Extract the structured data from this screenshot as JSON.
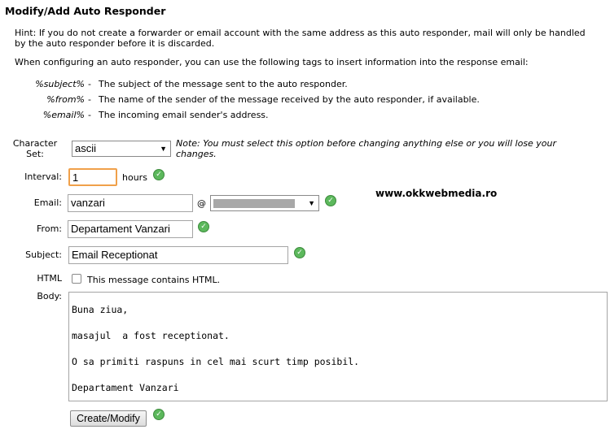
{
  "page": {
    "title": "Modify/Add Auto Responder",
    "hint": "Hint: If you do not create a forwarder or email account with the same address as this auto responder, mail will only be handled by the auto responder before it is discarded.",
    "intro": "When configuring an auto responder, you can use the following tags to insert information into the response email:"
  },
  "tags": [
    {
      "code": "%subject%",
      "dash": "-",
      "desc": "The subject of the message sent to the auto responder."
    },
    {
      "code": "%from%",
      "dash": "-",
      "desc": "The name of the sender of the message received by the auto responder, if available."
    },
    {
      "code": "%email%",
      "dash": "-",
      "desc": "The incoming email sender's address."
    }
  ],
  "form": {
    "charset_label_1": "Character",
    "charset_label_2": "Set:",
    "charset_value": "ascii",
    "charset_note": "Note: You must select this option before changing anything else or you will lose your changes.",
    "interval_label": "Interval:",
    "interval_value": "1",
    "interval_unit": "hours",
    "email_label": "Email:",
    "email_value": "vanzari",
    "email_at": "@",
    "from_label": "From:",
    "from_value": "Departament Vanzari",
    "subject_label": "Subject:",
    "subject_value": "Email Receptionat",
    "html_label": "HTML",
    "html_checkbox_label": "This message contains HTML.",
    "body_label": "Body:",
    "body_value": "Buna ziua,\nmasajul  a fost receptionat.\nO sa primiti raspuns in cel mai scurt timp posibil.\nDepartament Vanzari",
    "submit_label": "Create/Modify"
  },
  "watermark": "www.okkwebmedia.ro",
  "icons": {
    "ok": "check-circle-icon",
    "dropdown": "chevron-down-icon"
  },
  "colors": {
    "ok_green": "#5cb85c",
    "redacted_gray": "#a8a8a8",
    "focus_orange": "#f0a04a"
  }
}
